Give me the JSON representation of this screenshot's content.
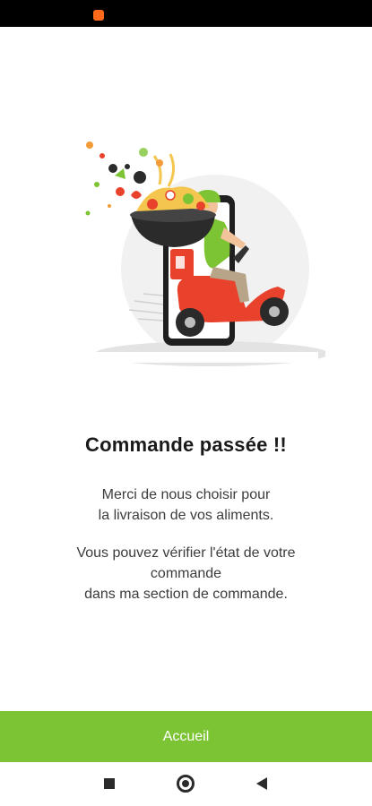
{
  "order_confirmation": {
    "title": "Commande passée !!",
    "message_line_1": "Merci de nous choisir pour",
    "message_line_2": "la livraison de vos aliments.",
    "info_line_1": "Vous pouvez vérifier l'état de votre",
    "info_line_2": "commande",
    "info_line_3": "dans ma section de commande."
  },
  "home_button": {
    "label": "Accueil"
  },
  "colors": {
    "accent_green": "#7dc434",
    "scooter_red": "#e8412c",
    "status_bar": "#000000"
  },
  "icons": {
    "status": "app-notification-icon",
    "illustration": "delivery-scooter-illustration",
    "nav_recents": "square-icon",
    "nav_home": "circle-icon",
    "nav_back": "triangle-back-icon"
  }
}
